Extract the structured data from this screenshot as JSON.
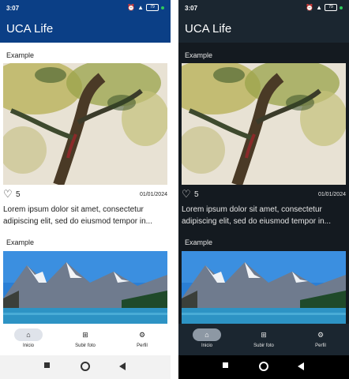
{
  "status": {
    "time": "3:07",
    "battery": "79"
  },
  "app": {
    "title": "UCA Life"
  },
  "posts": [
    {
      "author": "Example",
      "likes": "5",
      "date": "01/01/2024",
      "desc_line1": "Lorem ipsum dolor sit amet, consectetur",
      "desc_line2": "adipiscing elit, sed do eiusmod tempor in..."
    },
    {
      "author": "Example"
    }
  ],
  "nav": {
    "home": "Inicio",
    "upload": "Subir foto",
    "profile": "Perfil"
  },
  "icons": {
    "home": "home-icon",
    "upload": "add-photo-icon",
    "profile": "settings-gear-icon",
    "heart": "heart-outline-icon"
  },
  "colors": {
    "light_appbar": "#0b3f86",
    "dark_appbar": "#1b2630",
    "dark_bg": "#141a20",
    "light_pill": "#dfe3ea",
    "dark_pill": "#8d98a4"
  }
}
